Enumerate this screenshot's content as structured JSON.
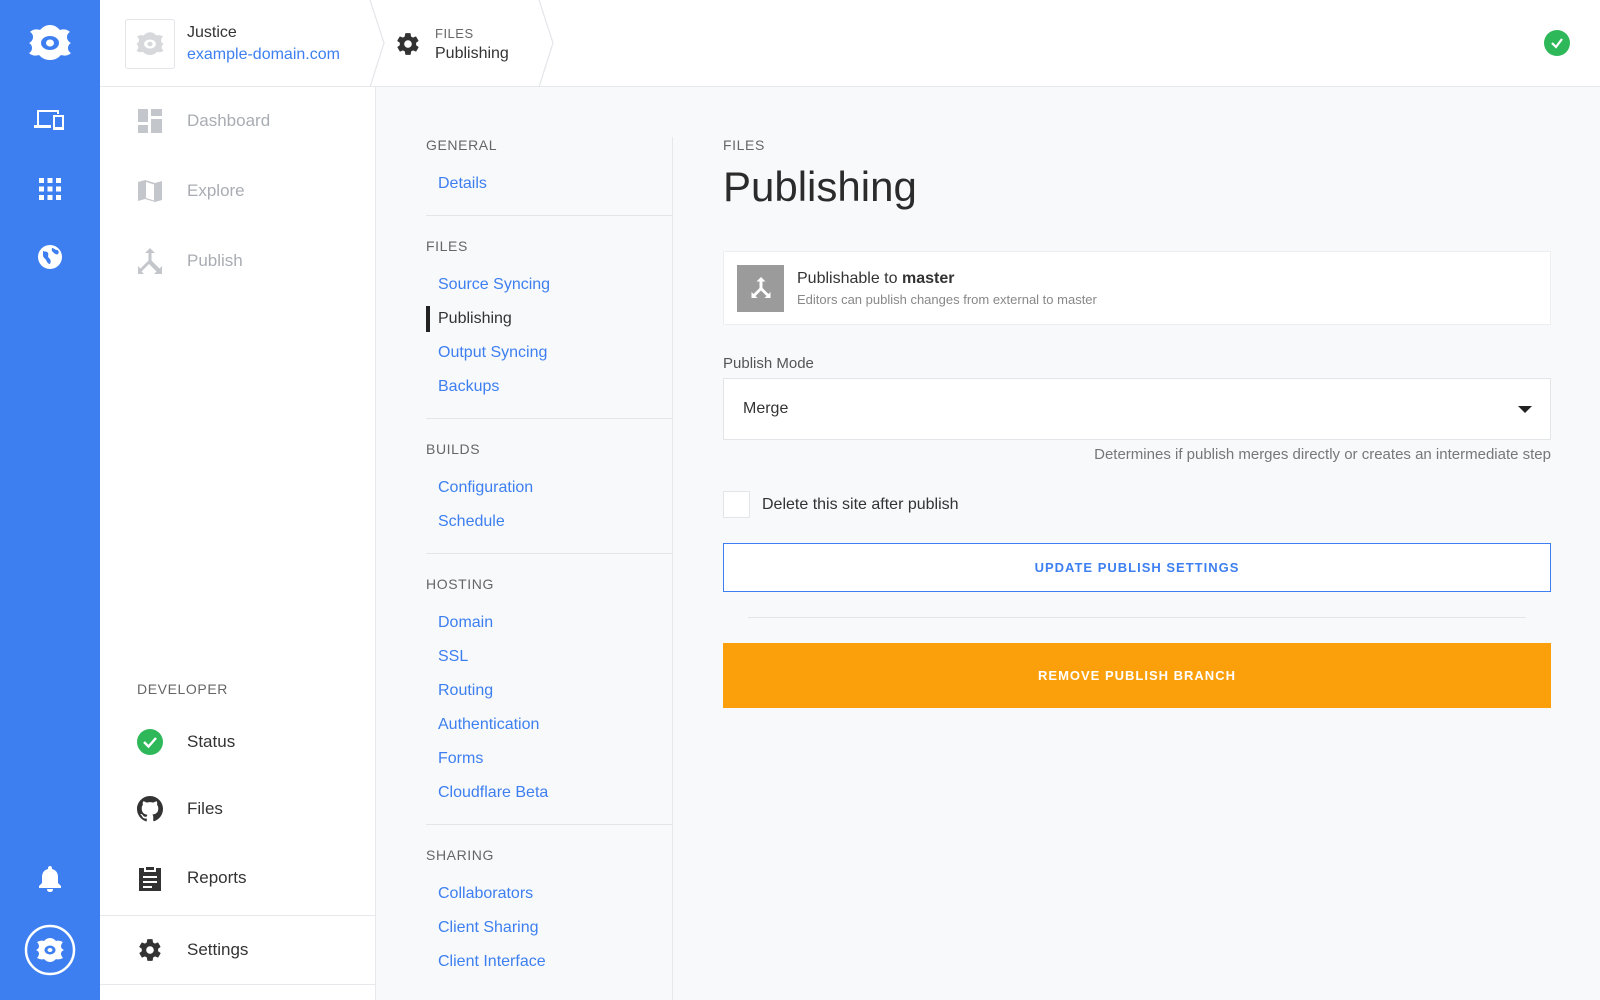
{
  "rail": {
    "icons": [
      "logo-icon",
      "devices-icon",
      "apps-grid-icon",
      "globe-icon",
      "bell-icon",
      "account-logo-icon"
    ]
  },
  "header": {
    "site_name": "Justice",
    "site_domain": "example-domain.com",
    "crumb_section": "FILES",
    "crumb_page": "Publishing",
    "status_icon": "check-icon"
  },
  "sidebar": {
    "items": [
      {
        "label": "Dashboard",
        "icon": "dashboard-icon"
      },
      {
        "label": "Explore",
        "icon": "map-icon"
      },
      {
        "label": "Publish",
        "icon": "merge-icon"
      }
    ],
    "developer_title": "DEVELOPER",
    "developer_items": [
      {
        "label": "Status",
        "icon": "check-circle-icon"
      },
      {
        "label": "Files",
        "icon": "github-icon"
      },
      {
        "label": "Reports",
        "icon": "clipboard-icon"
      },
      {
        "label": "Settings",
        "icon": "gear-icon"
      }
    ]
  },
  "subnav": {
    "groups": [
      {
        "title": "GENERAL",
        "links": [
          "Details"
        ]
      },
      {
        "title": "FILES",
        "links": [
          "Source Syncing",
          "Publishing",
          "Output Syncing",
          "Backups"
        ]
      },
      {
        "title": "BUILDS",
        "links": [
          "Configuration",
          "Schedule"
        ]
      },
      {
        "title": "HOSTING",
        "links": [
          "Domain",
          "SSL",
          "Routing",
          "Authentication",
          "Forms",
          "Cloudflare Beta"
        ]
      },
      {
        "title": "SHARING",
        "links": [
          "Collaborators",
          "Client Sharing",
          "Client Interface"
        ]
      }
    ],
    "current": "Publishing"
  },
  "main": {
    "kicker": "FILES",
    "title": "Publishing",
    "card_prefix": "Publishable to ",
    "card_branch": "master",
    "card_sub": "Editors can publish changes from external to master",
    "mode_label": "Publish Mode",
    "mode_value": "Merge",
    "mode_help": "Determines if publish merges directly or creates an intermediate step",
    "delete_label": "Delete this site after publish",
    "delete_checked": false,
    "update_button": "UPDATE PUBLISH SETTINGS",
    "remove_button": "REMOVE PUBLISH BRANCH"
  },
  "colors": {
    "accent": "#3d7ff0",
    "warning": "#fba00b",
    "success": "#2fb85a"
  }
}
